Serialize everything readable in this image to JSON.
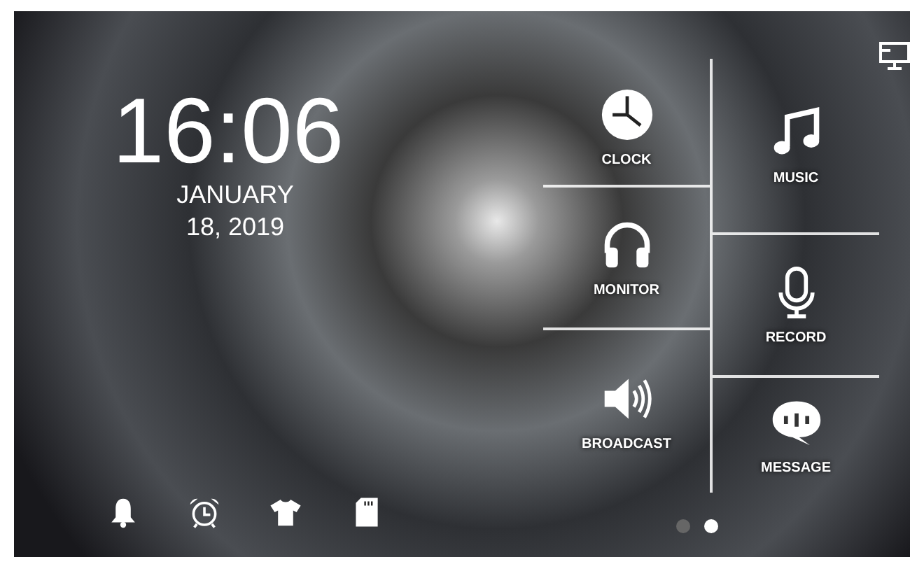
{
  "clock": {
    "time": "16:06",
    "date_lines": [
      "JANUARY",
      "18, 2019"
    ]
  },
  "tile_columns": [
    {
      "tiles": [
        {
          "label": "CLOCK",
          "kind": "clock"
        },
        {
          "label": "MONITOR",
          "kind": "headphones"
        },
        {
          "label": "BROADCAST",
          "kind": "speaker"
        }
      ]
    },
    {
      "tiles": [
        {
          "label": "MUSIC",
          "kind": "music"
        },
        {
          "label": "RECORD",
          "kind": "microphone"
        },
        {
          "label": "MESSAGE",
          "kind": "chat"
        }
      ]
    }
  ],
  "dock": [
    {
      "kind": "bell"
    },
    {
      "kind": "alarm"
    },
    {
      "kind": "shirt"
    },
    {
      "kind": "sdcard"
    }
  ],
  "pages": [
    {
      "selected": false
    },
    {
      "selected": true
    }
  ]
}
